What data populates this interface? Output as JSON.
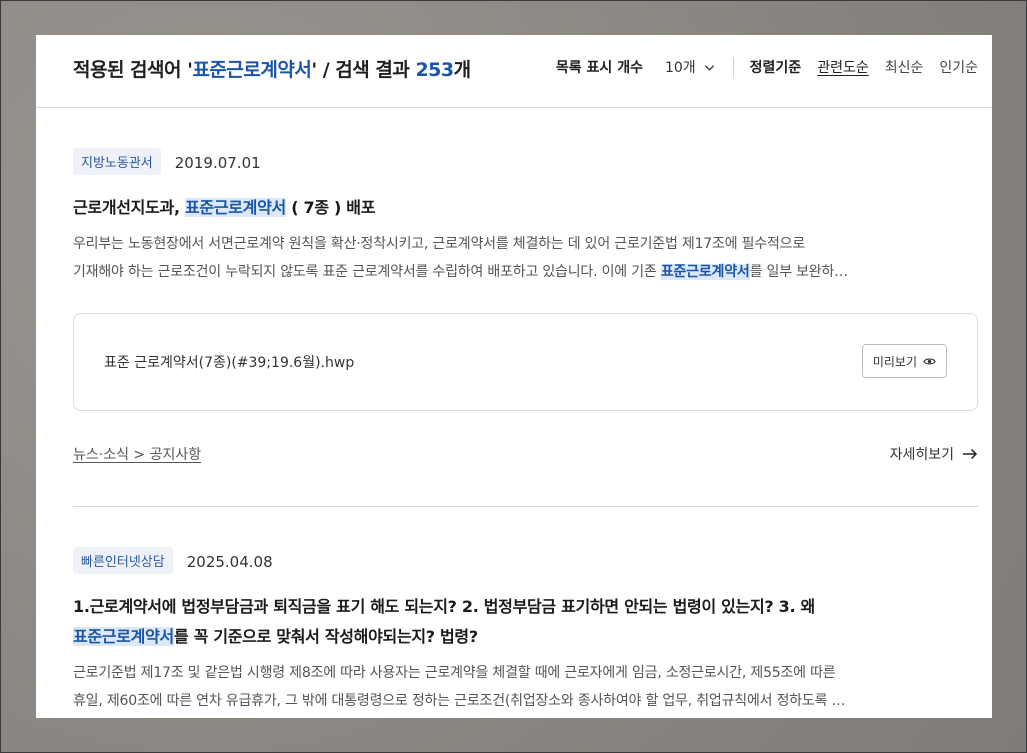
{
  "header": {
    "title_prefix": "적용된 검색어 '",
    "query": "표준근로계약서",
    "title_middle": "' / 검색 결과 ",
    "count": "253",
    "count_suffix": "개",
    "list_count_label": "목록 표시 개수",
    "list_count_value": "10개",
    "sort_label": "정렬기준",
    "sort_options": [
      "관련도순",
      "최신순",
      "인기순"
    ]
  },
  "results": [
    {
      "category": "지방노동관서",
      "date": "2019.07.01",
      "title_before": "근로개선지도과, ",
      "title_highlight": "표준근로계약서",
      "title_after": " ( 7종 ) 배포",
      "desc_line1": "우리부는 노동현장에서 서면근로계약 원칙을 확산·정착시키고, 근로계약서를 체결하는 데 있어 근로기준법 제17조에 필수적으로",
      "desc_line2_before": "기재해야 하는 근로조건이 누락되지 않도록 표준 근로계약서를 수립하여 배포하고 있습니다. 이에 기존 ",
      "desc_line2_highlight": "표준근로계약서",
      "desc_line2_after": "를 일부 보완하…",
      "attachment": "표준 근로계약서(7종)(#39;19.6월).hwp",
      "preview_label": "미리보기",
      "breadcrumb": "뉴스·소식 > 공지사항",
      "more_label": "자세히보기"
    },
    {
      "category": "빠른인터넷상담",
      "date": "2025.04.08",
      "title_line1": "1.근로계약서에 법정부담금과 퇴직금을 표기 해도 되는지? 2. 법정부담금 표기하면 안되는 법령이 있는지? 3. 왜",
      "title_line2_highlight": "표준근로계약서",
      "title_line2_after": "를 꼭 기준으로 맞춰서 작성해야되는지? 법령?",
      "desc_line1": "근로기준법 제17조 및 같은법 시행령 제8조에 따라 사용자는 근로계약을 체결할 때에 근로자에게 임금, 소정근로시간, 제55조에 따른",
      "desc_line2": "휴일, 제60조에 따른 연차 유급휴가, 그 밖에 대통령령으로 정하는 근로조건(취업장소와 종사하여야 할 업무, 취업규칙에서 정하도록 …"
    }
  ],
  "colors": {
    "accent": "#1a56a8",
    "highlight_bg": "#dce8f7",
    "badge_bg": "#eef2f8"
  },
  "icons": {
    "dropdown": "chevron-down-icon",
    "preview": "eye-icon",
    "more": "arrow-right-icon"
  }
}
